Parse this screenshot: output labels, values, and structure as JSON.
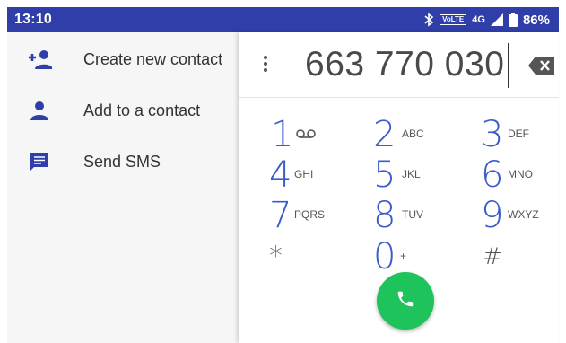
{
  "status_bar": {
    "time": "13:10",
    "network": "4G",
    "volte": "VoLTE",
    "battery_percent": "86%"
  },
  "menu": {
    "items": [
      {
        "label": "Create new contact",
        "icon": "add-person-icon"
      },
      {
        "label": "Add to a contact",
        "icon": "person-icon"
      },
      {
        "label": "Send SMS",
        "icon": "message-icon"
      }
    ]
  },
  "dialer": {
    "number": "663 770 030",
    "keys": [
      {
        "digit": "1",
        "letters": ""
      },
      {
        "digit": "2",
        "letters": "ABC"
      },
      {
        "digit": "3",
        "letters": "DEF"
      },
      {
        "digit": "4",
        "letters": "GHI"
      },
      {
        "digit": "5",
        "letters": "JKL"
      },
      {
        "digit": "6",
        "letters": "MNO"
      },
      {
        "digit": "7",
        "letters": "PQRS"
      },
      {
        "digit": "8",
        "letters": "TUV"
      },
      {
        "digit": "9",
        "letters": "WXYZ"
      },
      {
        "digit": "*",
        "letters": ""
      },
      {
        "digit": "0",
        "letters": "+"
      },
      {
        "digit": "#",
        "letters": ""
      }
    ]
  },
  "colors": {
    "status_bar": "#2f3ea8",
    "key_digit": "#3b5bcc",
    "call_button": "#1fc35b",
    "menu_icon": "#2f3ea8"
  }
}
